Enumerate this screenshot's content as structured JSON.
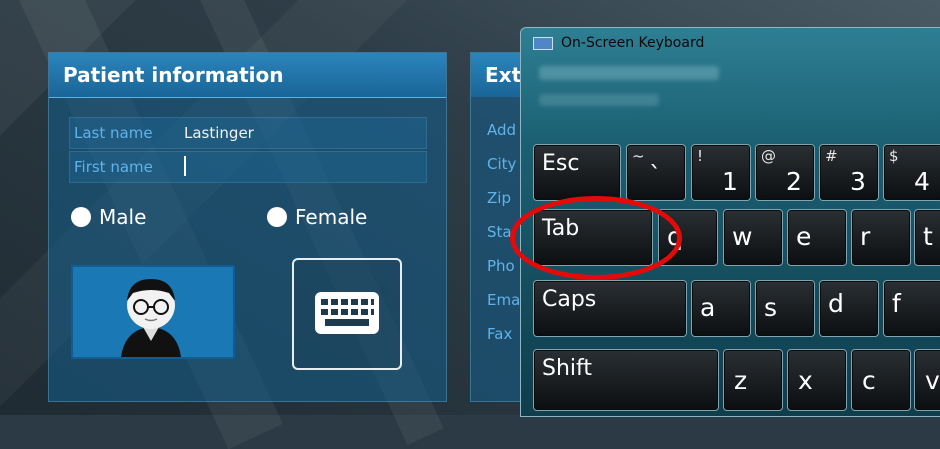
{
  "patient_panel": {
    "title": "Patient information",
    "fields": [
      {
        "label": "Last name",
        "value": "Lastinger"
      },
      {
        "label": "First name",
        "value": ""
      }
    ],
    "gender_options": [
      "Male",
      "Female"
    ]
  },
  "second_panel": {
    "title": "Ext",
    "labels": [
      "Add",
      "City",
      "Zip",
      "Sta",
      "Pho",
      "Ema",
      "Fax"
    ]
  },
  "osk": {
    "title": "On-Screen Keyboard",
    "row1": [
      {
        "main": "Esc",
        "sub": ""
      },
      {
        "main": "`",
        "sub": "~"
      },
      {
        "main": "1",
        "sub": "!"
      },
      {
        "main": "2",
        "sub": "@"
      },
      {
        "main": "3",
        "sub": "#"
      },
      {
        "main": "4",
        "sub": "$"
      }
    ],
    "row2": [
      "Tab",
      "q",
      "w",
      "e",
      "r",
      "t"
    ],
    "row3": [
      "Caps",
      "a",
      "s",
      "d",
      "f"
    ],
    "row4": [
      "Shift",
      "z",
      "x",
      "c",
      "v"
    ]
  },
  "colors": {
    "accent_blue": "#2a85bd",
    "label_blue": "#5fb3ea",
    "highlight_red": "#e50a0a"
  }
}
